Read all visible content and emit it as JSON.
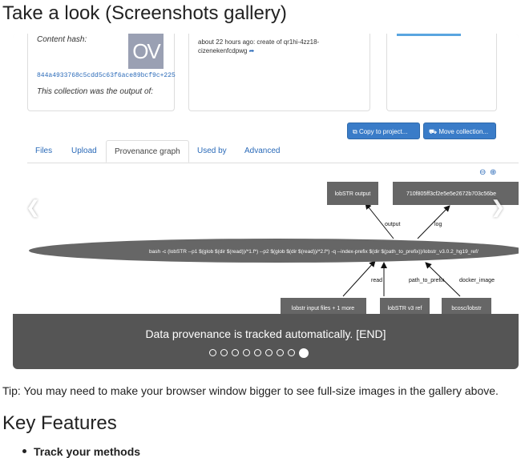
{
  "page": {
    "heading": "Take a look (Screenshots gallery)"
  },
  "slide": {
    "content_hash_label": "Content hash:",
    "content_hash_value": "844a4933768c5cdd5c63f6ace89bcf9c+225",
    "output_of_label": "This collection was the output of:",
    "avatar_text": "OV",
    "activity_text": "about 22 hours ago: create of qr1hi-4zz18-cizenekenfcdpwg",
    "buttons": {
      "copy": "Copy to project...",
      "move": "Move collection..."
    },
    "tabs": [
      {
        "label": "Files"
      },
      {
        "label": "Upload"
      },
      {
        "label": "Provenance graph"
      },
      {
        "label": "Used by"
      },
      {
        "label": "Advanced"
      }
    ],
    "graph": {
      "nodes": {
        "lobstr_output": "lobSTR output",
        "hash_node": "710f805ff3cf2e5e5e2672b703c56be",
        "bash_cmd": "bash -c (lobSTR --p1 $(glob $(dir $(read))/*1.f*) --p2 $(glob $(dir $(read))/*2.f*) -q --index-prefix $(dir $(path_to_prefix))/lobstr_v3.0.2_hg19_ref/",
        "input_files": "lobstr input files + 1 more",
        "ref": "lobSTR v3 ref",
        "docker": "bcosc/lobstr"
      },
      "edges": {
        "output": "output",
        "log": "log",
        "read": "read",
        "path_to_prefix": "path_to_prefix",
        "docker_image": "docker_image"
      }
    }
  },
  "carousel": {
    "caption": "Data provenance is tracked automatically. [END]",
    "slide_count": 9,
    "active_index": 8
  },
  "tip": "Tip: You may need to make your browser window bigger to see full-size images in the gallery above.",
  "features": {
    "heading": "Key Features",
    "items": [
      {
        "label": "Track your methods"
      }
    ]
  },
  "colors": {
    "accent": "#3a7cc8",
    "caption_band": "#555555",
    "graph_node": "#666666"
  }
}
